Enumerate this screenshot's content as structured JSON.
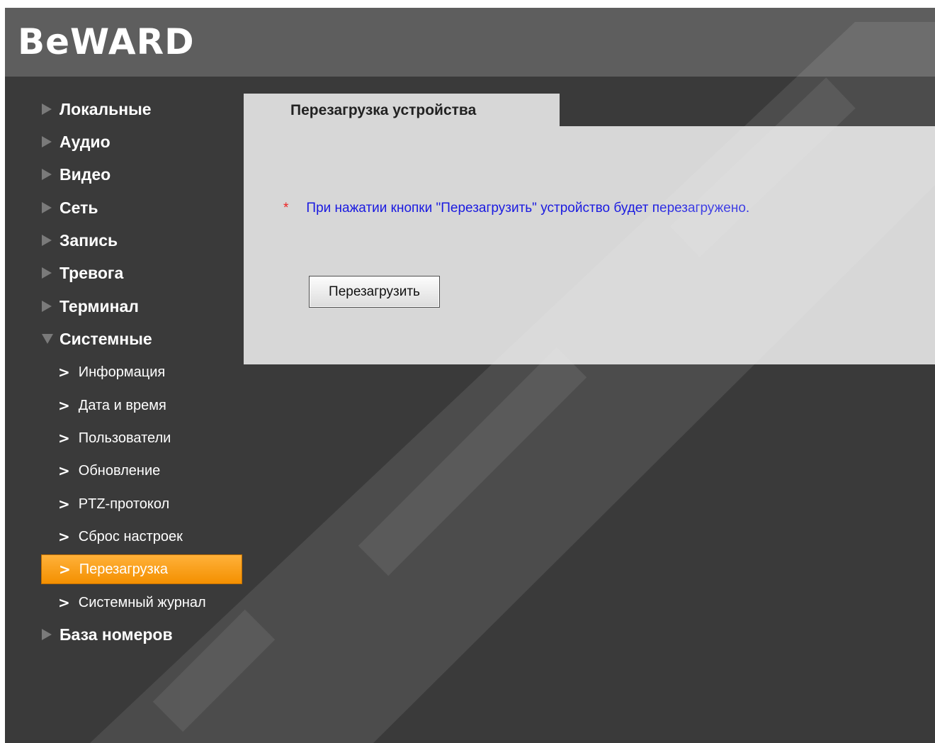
{
  "brand": {
    "logo_text": "BeWARD"
  },
  "sidebar": {
    "top_items": [
      {
        "label": "Локальные",
        "expanded": false
      },
      {
        "label": "Аудио",
        "expanded": false
      },
      {
        "label": "Видео",
        "expanded": false
      },
      {
        "label": "Сеть",
        "expanded": false
      },
      {
        "label": "Запись",
        "expanded": false
      },
      {
        "label": "Тревога",
        "expanded": false
      },
      {
        "label": "Терминал",
        "expanded": false
      },
      {
        "label": "Системные",
        "expanded": true
      },
      {
        "label": "База номеров",
        "expanded": false
      }
    ],
    "sub_items": [
      {
        "label": "Информация",
        "active": false
      },
      {
        "label": "Дата и время",
        "active": false
      },
      {
        "label": "Пользователи",
        "active": false
      },
      {
        "label": "Обновление",
        "active": false
      },
      {
        "label": "PTZ-протокол",
        "active": false
      },
      {
        "label": "Сброс настроек",
        "active": false
      },
      {
        "label": "Перезагрузка",
        "active": true
      },
      {
        "label": "Системный журнал",
        "active": false
      }
    ],
    "chevron": ">"
  },
  "main": {
    "tab_title": "Перезагрузка устройства",
    "note_marker": "*",
    "note_text": "При нажатии кнопки \"Перезагрузить\" устройство будет перезагружено.",
    "reboot_button_label": "Перезагрузить"
  },
  "colors": {
    "background": "#3a3a3a",
    "header": "#5e5e5e",
    "panel": "#d7d7d7",
    "active_item": "#f7a21b",
    "note_text": "#1a1ae0",
    "note_marker": "#ee2222"
  }
}
